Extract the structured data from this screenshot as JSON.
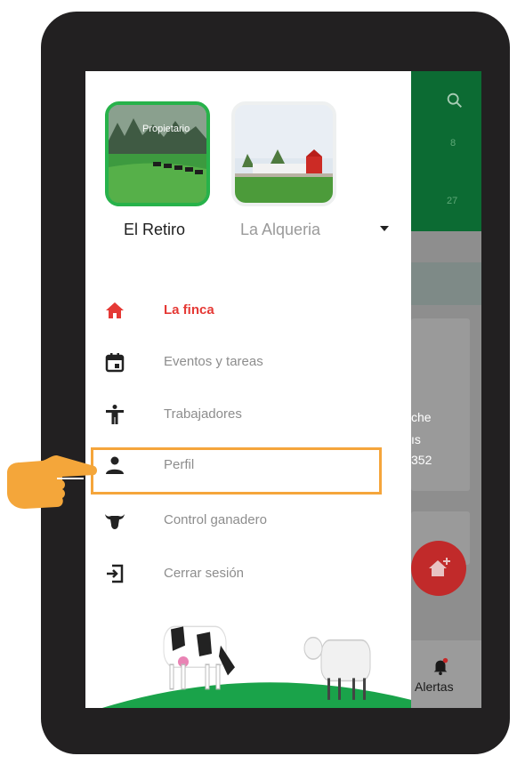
{
  "drawer": {
    "farms": [
      {
        "name": "El Retiro",
        "tag": "Propietario",
        "selected": true
      },
      {
        "name": "La Alqueria",
        "tag": "",
        "selected": false
      }
    ],
    "menu": [
      {
        "label": "La finca",
        "icon": "home-icon",
        "active": true
      },
      {
        "label": "Eventos y tareas",
        "icon": "calendar-icon",
        "active": false
      },
      {
        "label": "Trabajadores",
        "icon": "person-standing-icon",
        "active": false
      },
      {
        "label": "Perfil",
        "icon": "person-icon",
        "active": false
      },
      {
        "label": "Control ganadero",
        "icon": "cow-head-icon",
        "active": false
      },
      {
        "label": "Cerrar sesión",
        "icon": "logout-icon",
        "active": false
      }
    ]
  },
  "background_app": {
    "numbers": [
      "8",
      "27"
    ],
    "card_text": [
      "che",
      "ıs",
      "352"
    ],
    "bottom_nav": {
      "alerts_label": "Alertas"
    }
  },
  "colors": {
    "accent_green": "#27b24a",
    "active_red": "#e53935",
    "highlight_orange": "#f5a53b",
    "header_green": "#0c6b33"
  },
  "annotation": {
    "highlighted_item": "Perfil"
  }
}
